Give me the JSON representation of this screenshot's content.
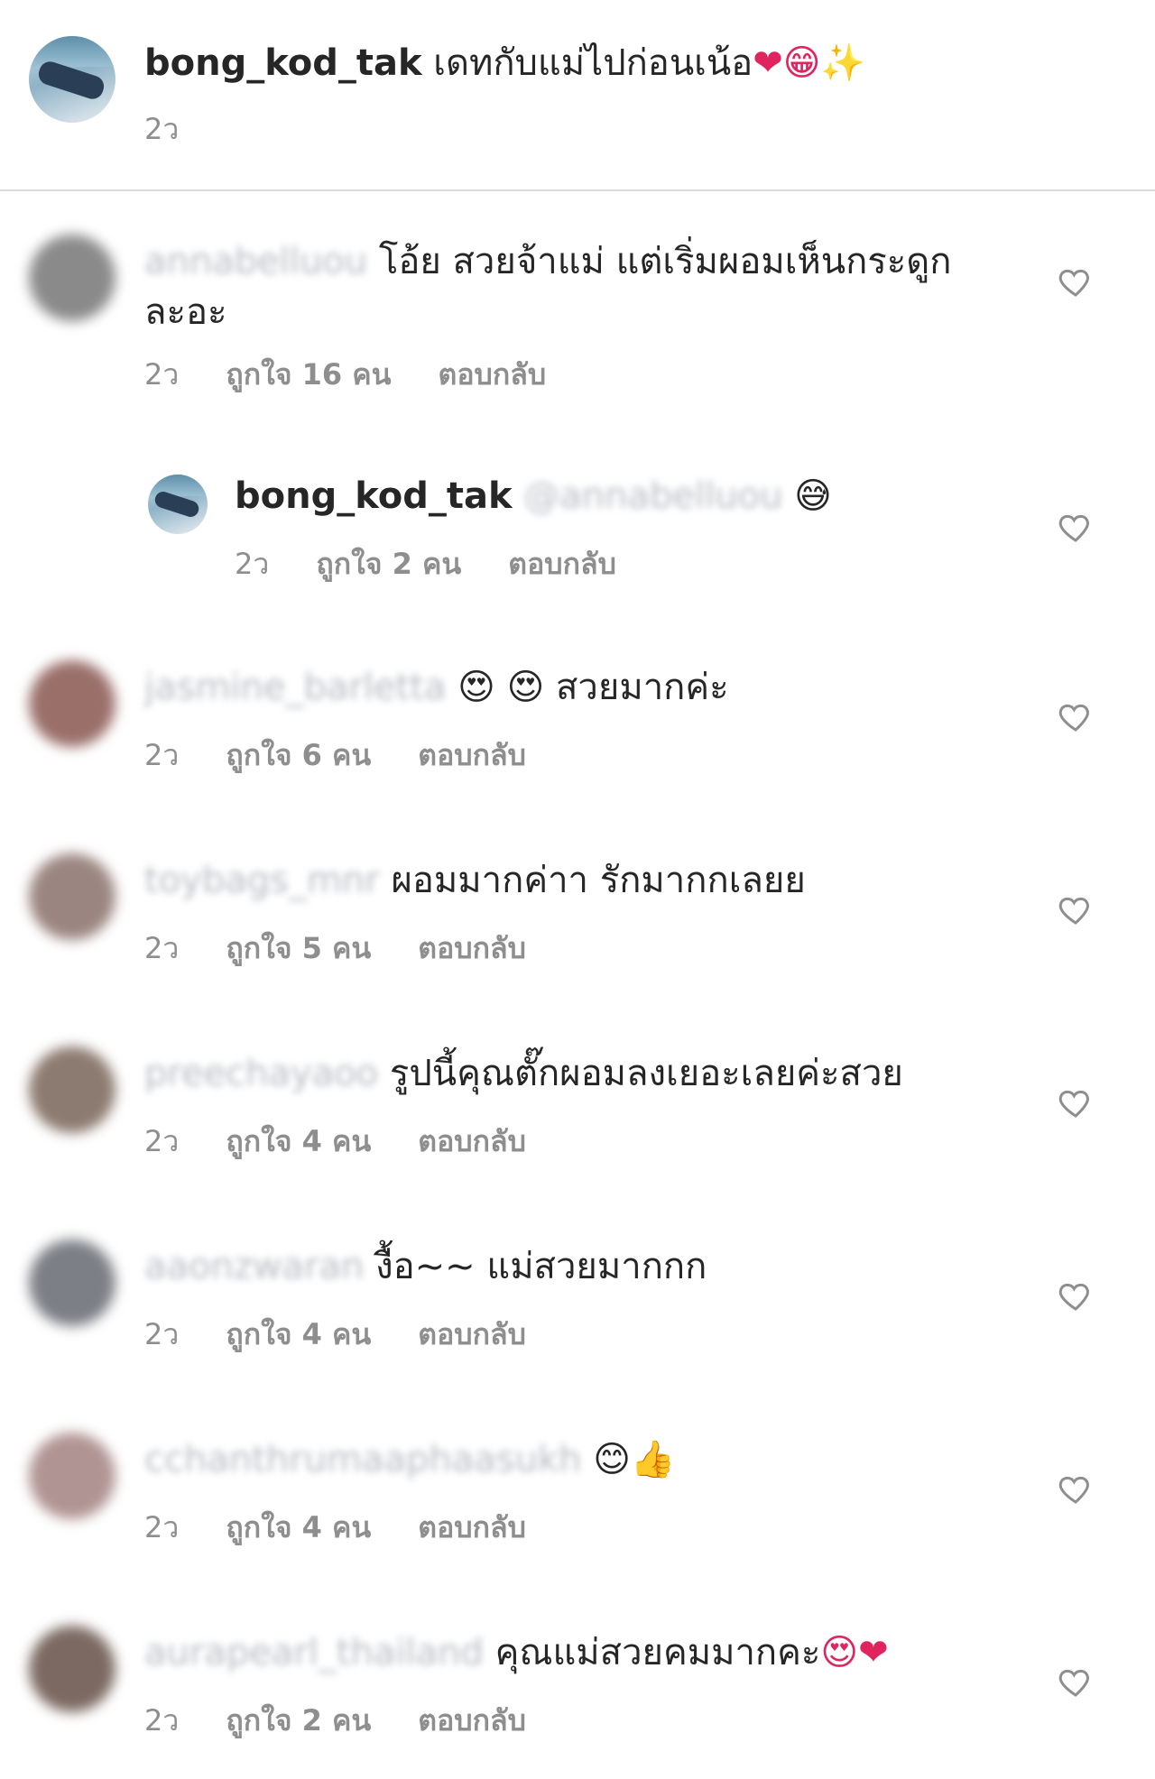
{
  "caption": {
    "username": "bong_kod_tak",
    "text": "เดทกับแม่ไปก่อนเน้อ",
    "emojis": "❤😁✨",
    "time": "2ว"
  },
  "reply_label": "ตอบกลับ",
  "comments": [
    {
      "username": "annabelluou",
      "text_line1": "โอ้ย สวยจ้าแม่ แต่เริ่มผอมเห็นกระดูก",
      "text_line2": "ละอะ",
      "time": "2ว",
      "likes": "ถูกใจ 16 คน",
      "avatar_color": "#8a8a8a"
    },
    {
      "username": "bong_kod_tak",
      "mention": "@annabelluou",
      "emoji": "😅",
      "time": "2ว",
      "likes": "ถูกใจ 2 คน"
    },
    {
      "username": "jasmine_barletta",
      "emojis": "😍 😍",
      "text": "สวยมากค่ะ",
      "time": "2ว",
      "likes": "ถูกใจ 6 คน",
      "avatar_color": "#9a6f6a"
    },
    {
      "username": "toybags_mnr",
      "text": "ผอมมากค่าา รักมากกเลยย",
      "time": "2ว",
      "likes": "ถูกใจ 5 คน",
      "avatar_color": "#9b8580"
    },
    {
      "username": "preechayaoo",
      "text": "รูปนี้คุณตั๊กผอมลงเยอะเลยค่ะสวย",
      "time": "2ว",
      "likes": "ถูกใจ 4 คน",
      "avatar_color": "#8c7b70"
    },
    {
      "username": "aaonzwaran",
      "text": "งื้อ~~ แม่สวยมากกก",
      "time": "2ว",
      "likes": "ถูกใจ 4 คน",
      "avatar_color": "#7d7f86"
    },
    {
      "username": "cchanthrumaaphaasukh",
      "emojis": "😊👍",
      "time": "2ว",
      "likes": "ถูกใจ 4 คน",
      "avatar_color": "#b09493"
    },
    {
      "username": "aurapearl_thailand",
      "text": "คุณแม่สวยคมมากคะ",
      "emojis": "😍❤",
      "time": "2ว",
      "likes": "ถูกใจ 2 คน",
      "avatar_color": "#7c6a62"
    }
  ]
}
